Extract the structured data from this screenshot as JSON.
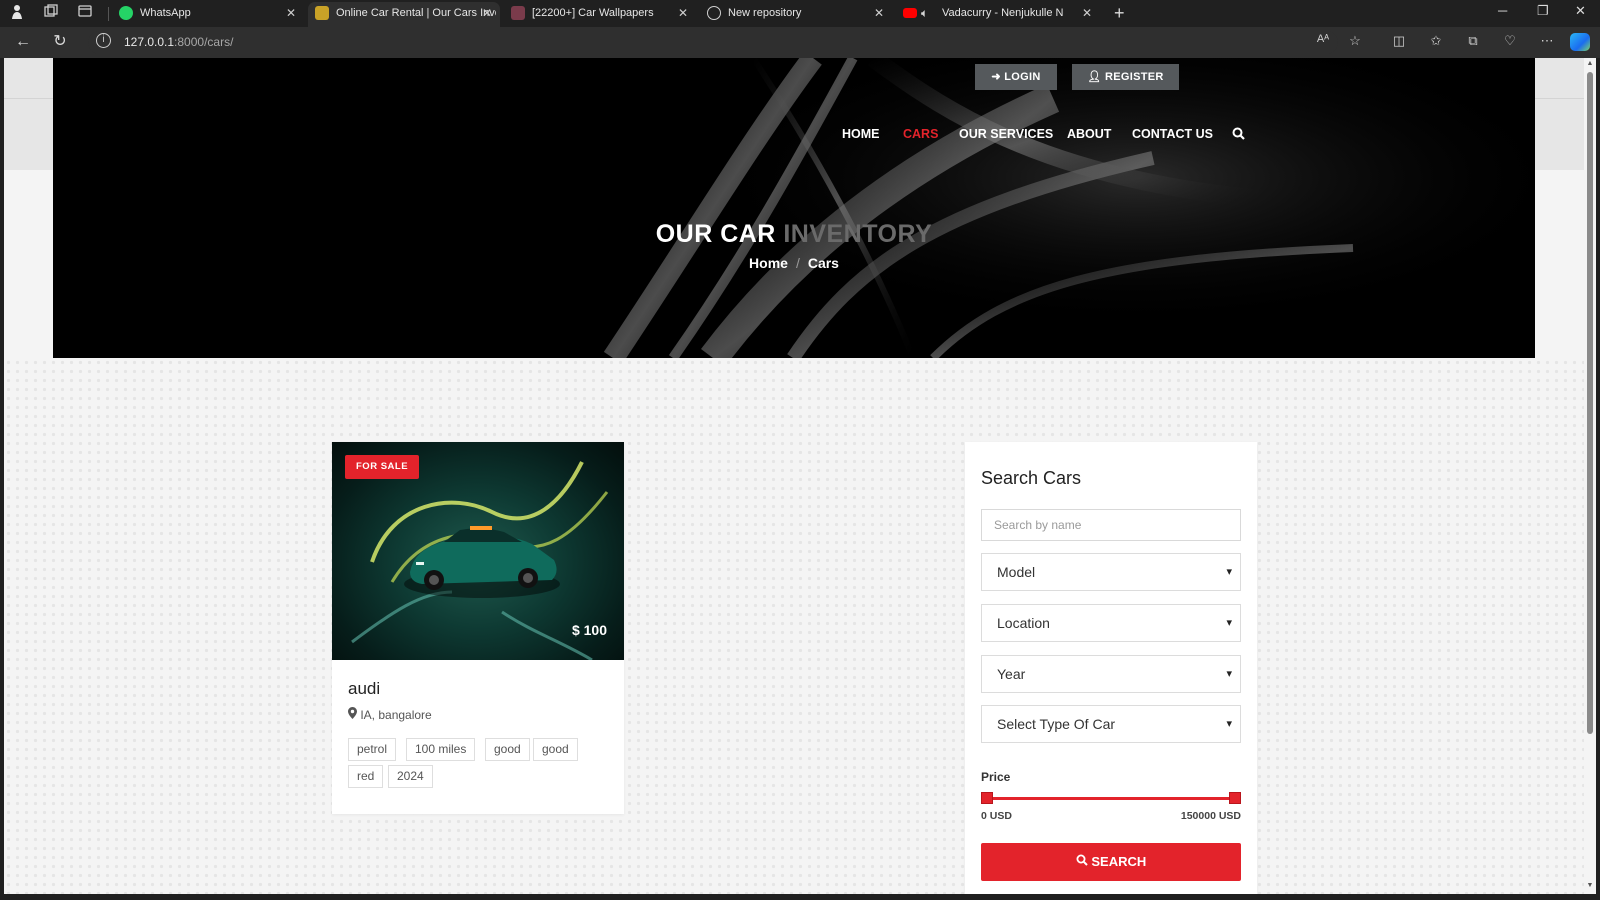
{
  "browser": {
    "tabs": [
      {
        "title": "WhatsApp",
        "favicon_color": "#25d366"
      },
      {
        "title": "Online Car Rental | Our Cars Inve",
        "favicon_color": "#c9a227"
      },
      {
        "title": "[22200+] Car Wallpapers",
        "favicon_color": "#7a3b4b"
      },
      {
        "title": "New repository",
        "favicon_color": "#d0d0d0"
      },
      {
        "title": "Vadacurry - Nenjukulle Nee",
        "favicon_color": "#ff0000"
      }
    ],
    "url_host": "127.0.0.1",
    "url_rest": ":8000/cars/",
    "read_aloud": "Aᴬ"
  },
  "header": {
    "login_label": "LOGIN",
    "register_label": "REGISTER",
    "nav": [
      "HOME",
      "CARS",
      "OUR SERVICES",
      "ABOUT",
      "CONTACT US"
    ],
    "active_nav": "CARS",
    "title_strong": "OUR CAR",
    "title_muted": "INVENTORY",
    "breadcrumb": {
      "home": "Home",
      "sep": "/",
      "current": "Cars"
    }
  },
  "listing": {
    "badge": "FOR SALE",
    "price": "$ 100",
    "name": "audi",
    "location": "IA, bangalore",
    "tags": [
      "petrol",
      "100 miles",
      "good",
      "good",
      "red",
      "2024"
    ]
  },
  "search": {
    "title": "Search Cars",
    "name_placeholder": "Search by name",
    "model": "Model",
    "location": "Location",
    "year": "Year",
    "type": "Select Type Of Car",
    "price_label": "Price",
    "price_min": "0 USD",
    "price_max": "150000 USD",
    "price_range_fraction": [
      0,
      1
    ],
    "button": "SEARCH"
  },
  "colors": {
    "accent": "#e3232b",
    "auth_button": "#55595c",
    "hero_bg": "#000000"
  }
}
